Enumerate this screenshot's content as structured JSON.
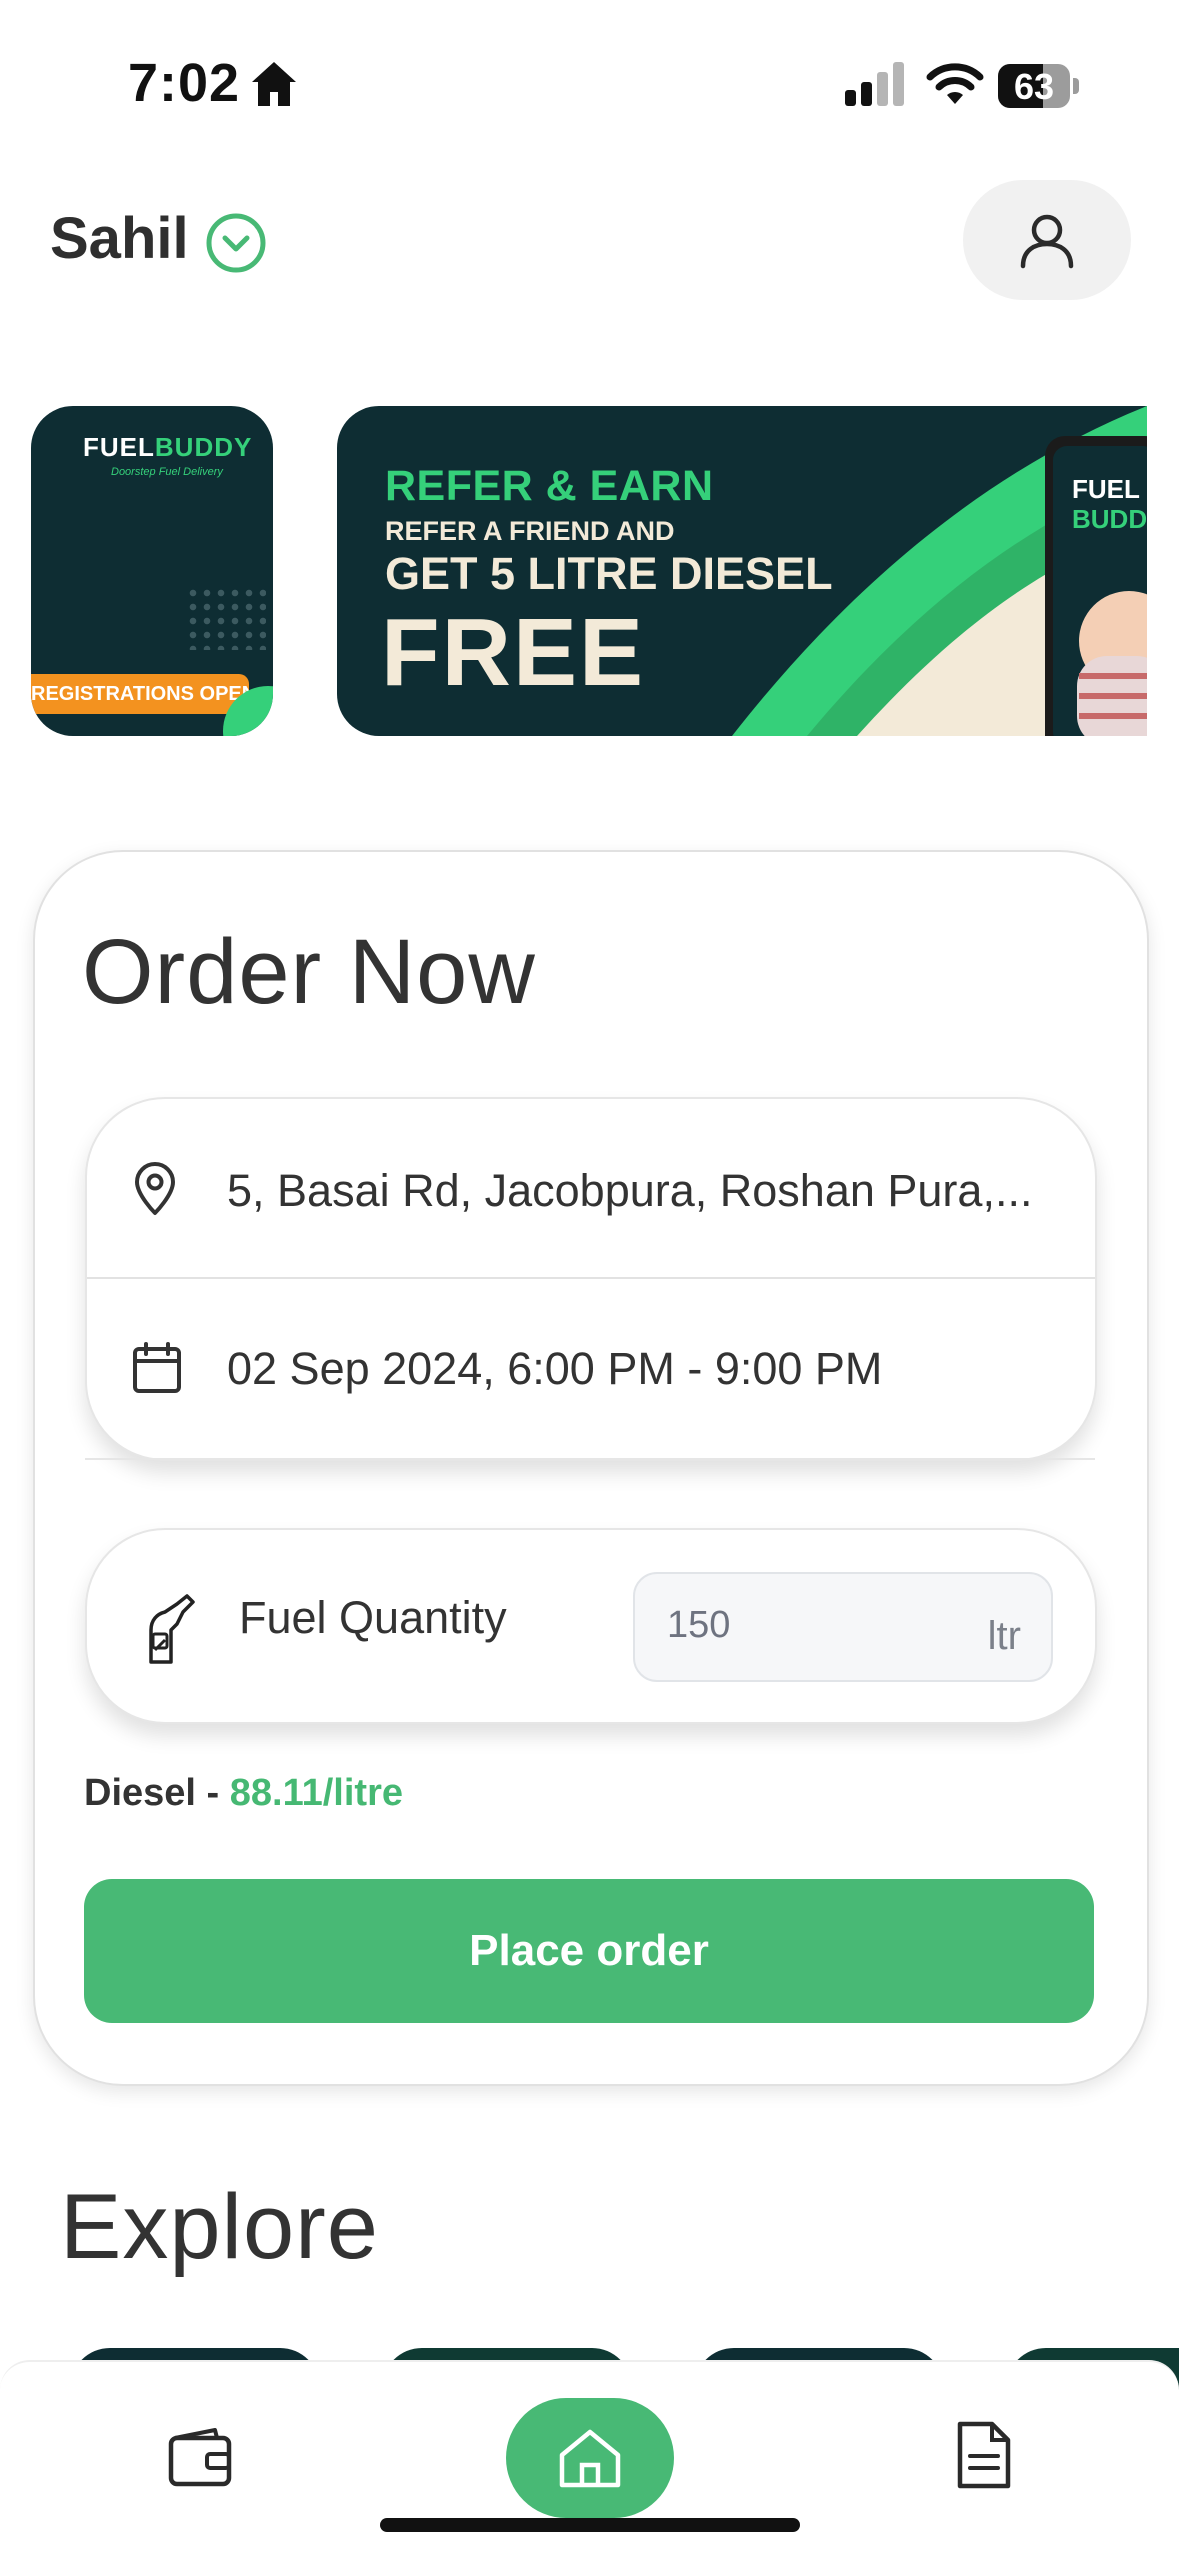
{
  "status_bar": {
    "time": "7:02",
    "battery": "63"
  },
  "header": {
    "user_name": "Sahil"
  },
  "banners": {
    "small": {
      "logo_a": "FUEL",
      "logo_b": "BUDDY",
      "tagline": "Doorstep Fuel Delivery",
      "badge": "REGISTRATIONS OPEN"
    },
    "main": {
      "headline": "REFER & EARN",
      "line1": "REFER A FRIEND AND",
      "line2": "GET 5 LITRE DIESEL",
      "line3": "FREE",
      "phone_logo_a": "FUEL",
      "phone_logo_b": "BUDD"
    }
  },
  "order": {
    "title": "Order Now",
    "address": "5, Basai Rd, Jacobpura, Roshan Pura,...",
    "slot": "02 Sep 2024, 6:00 PM - 9:00 PM",
    "fuel_label": "Fuel Quantity",
    "quantity": "150",
    "unit": "ltr",
    "fuel_type": "Diesel",
    "price_sep": " - ",
    "price": "88.11/litre",
    "place_button": "Place order"
  },
  "explore": {
    "title": "Explore"
  },
  "colors": {
    "accent": "#48b975",
    "banner_dark": "#0e2d33",
    "banner_green": "#35d07a"
  },
  "nav": {
    "items": [
      "wallet-icon",
      "home-icon",
      "document-icon"
    ],
    "active": "home-icon"
  }
}
